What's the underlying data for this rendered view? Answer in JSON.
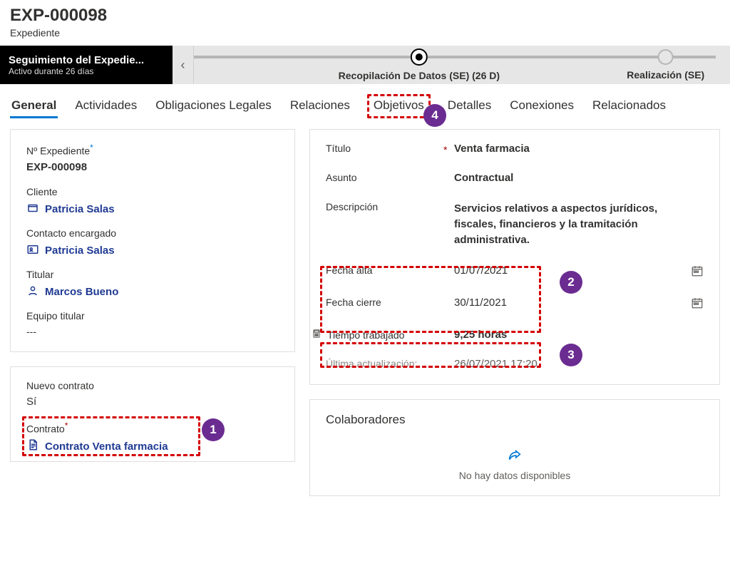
{
  "header": {
    "title": "EXP-000098",
    "subtitle": "Expediente"
  },
  "bpf": {
    "name": "Seguimiento del Expedie...",
    "status": "Activo durante 26 días",
    "stage1": "Recopilación De Datos (SE)  (26 D)",
    "stage2": "Realización (SE)"
  },
  "tabs": {
    "general": "General",
    "actividades": "Actividades",
    "obligaciones": "Obligaciones Legales",
    "relaciones": "Relaciones",
    "objetivos": "Objetivos",
    "detalles": "Detalles",
    "conexiones": "Conexiones",
    "relacionados": "Relacionados"
  },
  "left": {
    "num_label": "Nº Expediente",
    "num_value": "EXP-000098",
    "cliente_label": "Cliente",
    "cliente_value": "Patricia Salas",
    "contacto_label": "Contacto encargado",
    "contacto_value": "Patricia Salas",
    "titular_label": "Titular",
    "titular_value": "Marcos Bueno",
    "equipo_label": "Equipo titular",
    "equipo_value": "---",
    "nuevo_label": "Nuevo contrato",
    "nuevo_value": "Sí",
    "contrato_label": "Contrato",
    "contrato_value": "Contrato Venta farmacia"
  },
  "right": {
    "titulo_label": "Título",
    "titulo_value": "Venta farmacia",
    "asunto_label": "Asunto",
    "asunto_value": "Contractual",
    "desc_label": "Descripción",
    "desc_value": "Servicios relativos a aspectos jurídicos, fiscales, financieros y la tramitación administrativa.",
    "alta_label": "Fecha alta",
    "alta_value": "01/07/2021",
    "cierre_label": "Fecha cierre",
    "cierre_value": "30/11/2021",
    "tiempo_label": "Tiempo trabajado",
    "tiempo_value": "9,25 horas",
    "actu_label": "Última actualización:",
    "actu_value": "26/07/2021 17:20"
  },
  "colab": {
    "title": "Colaboradores",
    "empty": "No hay datos disponibles"
  },
  "callouts": {
    "c1": "1",
    "c2": "2",
    "c3": "3",
    "c4": "4"
  }
}
